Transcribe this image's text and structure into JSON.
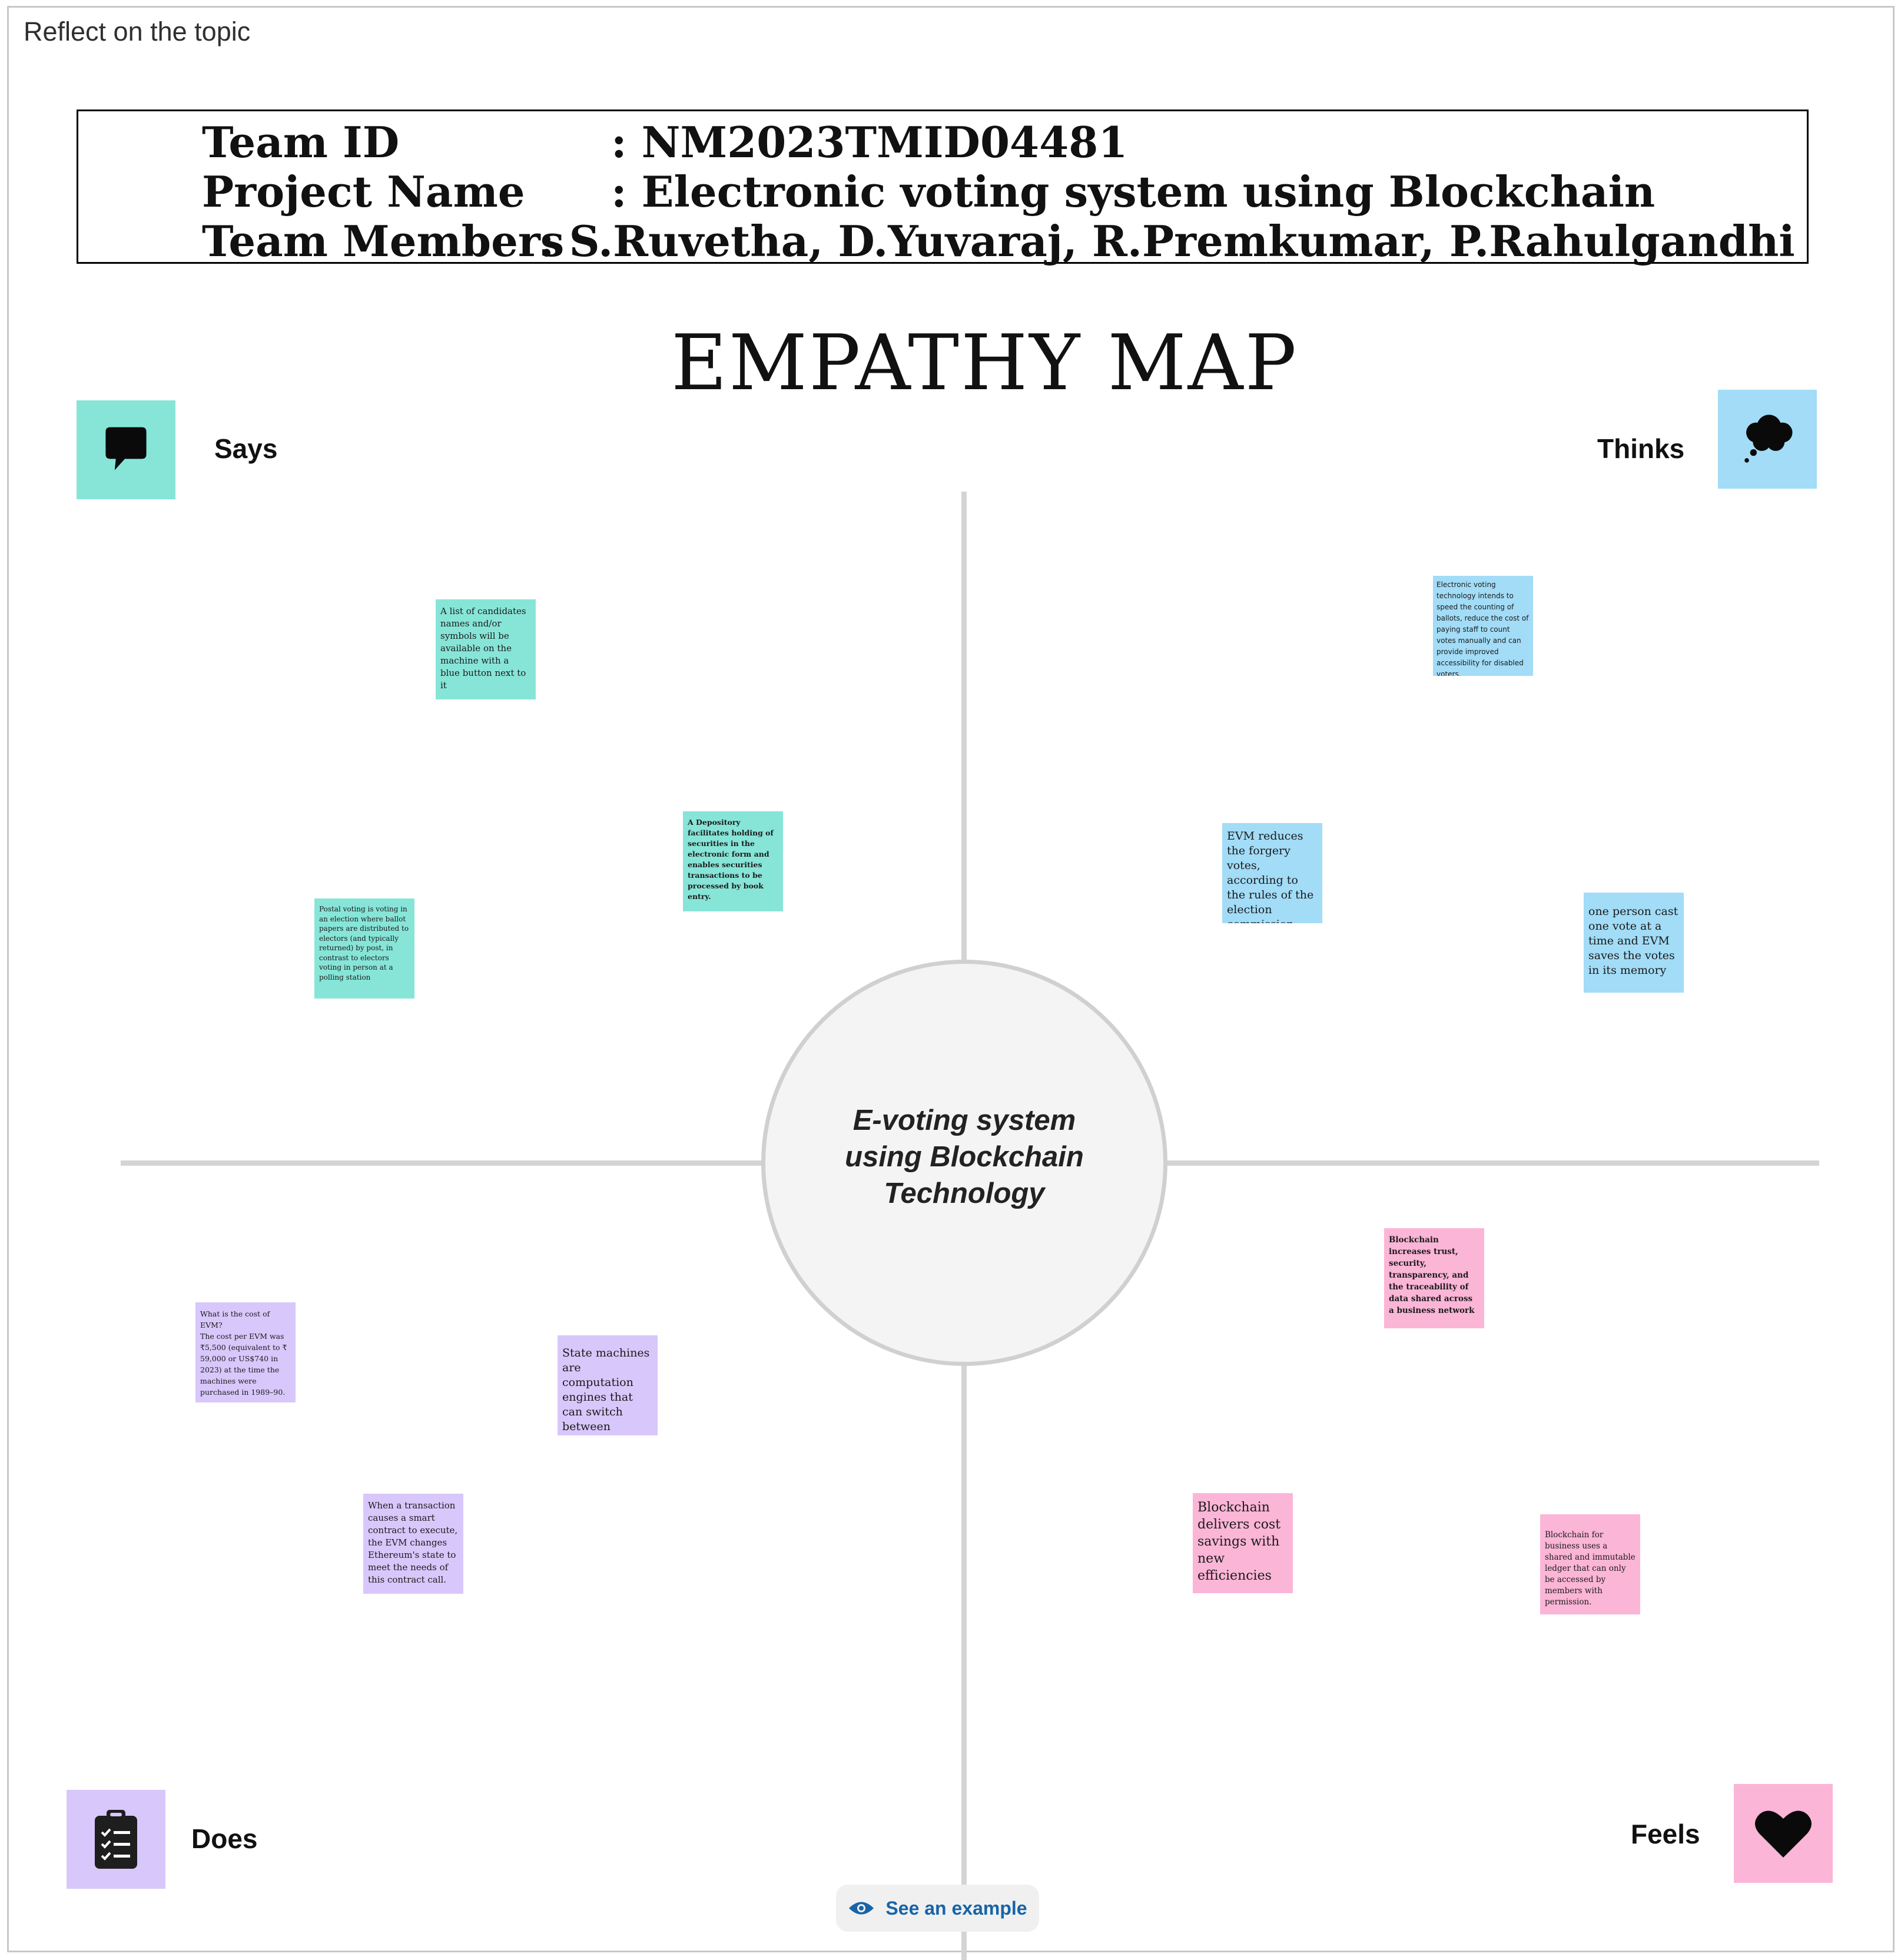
{
  "topic_label": "Reflect on the topic",
  "header": {
    "team_id_label": "Team ID",
    "team_id_value": ":  NM2023TMID04481",
    "project_label": "Project Name",
    "project_value": ":  Electronic voting system using Blockchain",
    "members_label": "Team Members",
    "members_value": ": S.Ruvetha, D.Yuvaraj, R.Premkumar, P.Rahulgandhi"
  },
  "title": "EMPATHY MAP",
  "center": "E-voting system using Blockchain Technology",
  "quadrants": {
    "says": {
      "label": "Says",
      "icon": "speech-bubble-icon",
      "color": "#87e5d8",
      "notes": [
        " A list of candidates names and/or symbols will be available on the machine with a blue button next to it",
        "A Depository facilitates holding of securities in the electronic form and enables securities transactions to be processed by book entry.",
        "Postal voting is voting in an election where ballot papers are distributed to electors (and typically returned) by post, in contrast to electors voting in person at a polling station"
      ]
    },
    "thinks": {
      "label": "Thinks",
      "icon": "thought-cloud-icon",
      "color": "#a2dcf7",
      "notes": [
        "Electronic voting technology intends to speed the counting of ballots, reduce the cost of paying staff to count votes manually and can provide improved accessibility for disabled voters.",
        "EVM reduces the forgery votes, according to the rules of the election commission",
        "one person cast one vote at a time and EVM saves the votes in its memory"
      ]
    },
    "does": {
      "label": "Does",
      "icon": "clipboard-checklist-icon",
      "color": "#d8c7fb",
      "notes": [
        "What is the cost of EVM?\nThe cost per EVM was ₹5,500 (equivalent to ₹ 59,000 or US$740 in 2023) at the time the machines were purchased in 1989–90.",
        "State machines are computation engines that can switch between various states.",
        "When a transaction causes a smart contract to execute, the EVM changes Ethereum's state to meet the needs of this contract call."
      ]
    },
    "feels": {
      "label": "Feels",
      "icon": "heart-icon",
      "color": "#fbb5d7",
      "notes": [
        "Blockchain increases trust, security, transparency, and the traceability of data shared across a business network",
        "Blockchain delivers cost savings with new efficiencies",
        " Blockchain for business uses a shared and immutable ledger that can only be accessed by members with permission."
      ]
    }
  },
  "example_button": {
    "label": "See an example",
    "icon": "eye-icon"
  }
}
